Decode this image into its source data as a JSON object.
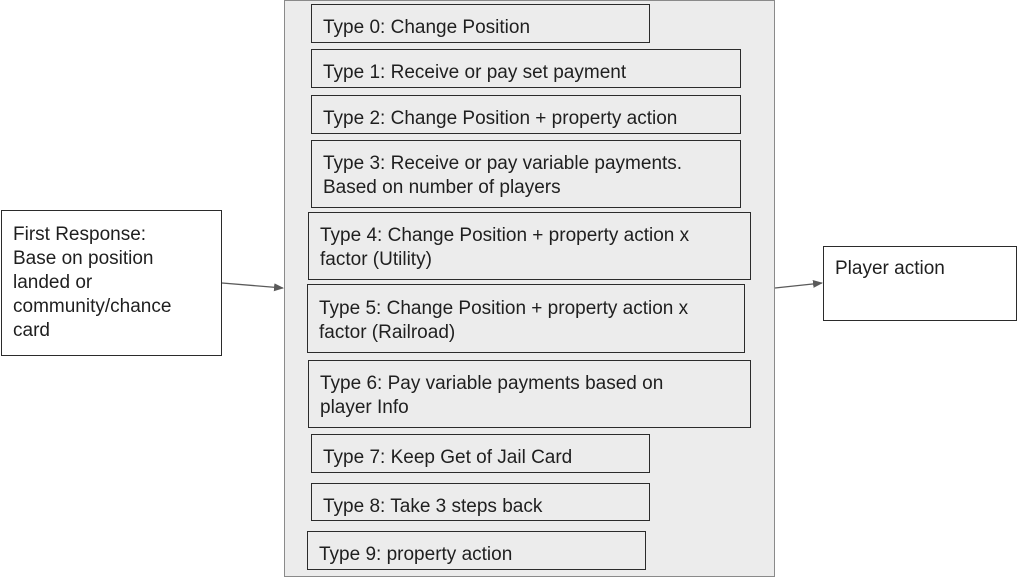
{
  "input_box": {
    "text": "First Response:\nBase on position\nlanded or\ncommunity/chance\ncard"
  },
  "output_box": {
    "text": "Player action"
  },
  "types": [
    {
      "text": "Type 0: Change Position"
    },
    {
      "text": "Type 1: Receive or pay set payment"
    },
    {
      "text": "Type 2: Change Position + property action"
    },
    {
      "text": "Type 3: Receive or pay variable payments.\nBased on number of players"
    },
    {
      "text": "Type 4: Change Position + property action  x\nfactor (Utility)"
    },
    {
      "text": "Type 5: Change Position + property action  x\nfactor (Railroad)"
    },
    {
      "text": "Type 6: Pay variable payments based on\nplayer Info"
    },
    {
      "text": "Type 7: Keep Get of Jail Card"
    },
    {
      "text": "Type 8: Take 3 steps back"
    },
    {
      "text": "Type 9: property action"
    }
  ],
  "colors": {
    "line": "#2b2b2b",
    "container_fill": "#ececec",
    "arrow": "#5a5a5a"
  }
}
